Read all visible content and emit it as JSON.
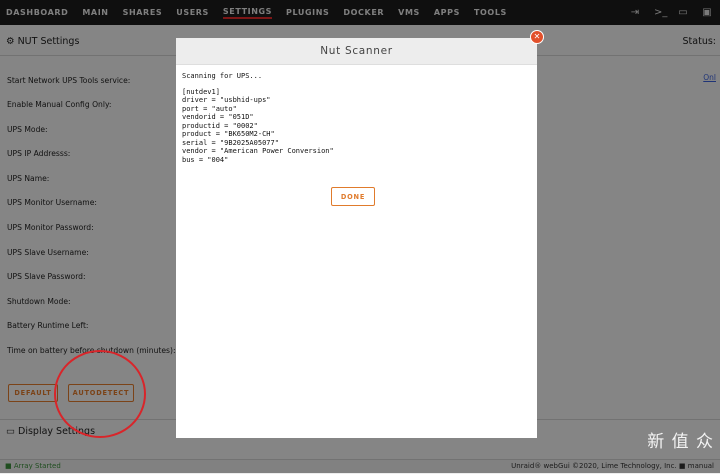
{
  "nav": {
    "tabs": [
      "DASHBOARD",
      "MAIN",
      "SHARES",
      "USERS",
      "SETTINGS",
      "PLUGINS",
      "DOCKER",
      "VMS",
      "APPS",
      "TOOLS"
    ],
    "active": "SETTINGS",
    "icons": [
      "logout-icon",
      "terminal-icon",
      "feedback-icon",
      "monitor-icon"
    ]
  },
  "section": {
    "title": "NUT Settings",
    "status": "Status:"
  },
  "form": {
    "labels": [
      "Start Network UPS Tools service:",
      "Enable Manual Config Only:",
      "UPS Mode:",
      "UPS IP Addresss:",
      "UPS Name:",
      "UPS Monitor Username:",
      "UPS Monitor Password:",
      "UPS Slave Username:",
      "UPS Slave Password:",
      "Shutdown Mode:",
      "Battery Runtime Left:",
      "Time on battery before shutdown (minutes):"
    ],
    "info_link": "Onl",
    "default_button": "DEFAULT",
    "autodetect_button": "AUTODETECT"
  },
  "display_settings": "Display Settings",
  "footer": {
    "status": "Array Started",
    "copyright": "Unraid® webGui ©2020, Lime Technology, Inc.",
    "manual": "manual"
  },
  "modal": {
    "title": "Nut Scanner",
    "scanning": "Scanning for UPS...",
    "lines": [
      "[nutdev1]",
      "driver = \"usbhid-ups\"",
      "port = \"auto\"",
      "vendorid = \"051D\"",
      "productid = \"0002\"",
      "product = \"BK650M2-CH\"",
      "serial = \"9B2025A05077\"",
      "vendor = \"American Power Conversion\"",
      "bus = \"004\""
    ],
    "done_button": "DONE"
  },
  "watermark": "新 值 众"
}
